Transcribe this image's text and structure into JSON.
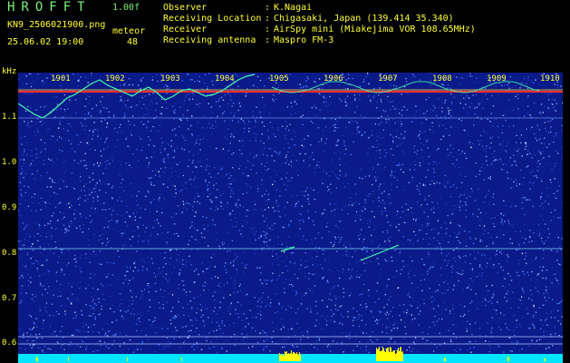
{
  "header": {
    "app_title": "HROFFT",
    "version": "1.00f",
    "filename": "KN9_2506021900.png",
    "meteor_label": "meteor",
    "timestamp": "25.06.02 19:00",
    "meteor_count": "48",
    "info": [
      {
        "key": "Observer",
        "value": "K.Nagai"
      },
      {
        "key": "Receiving Location",
        "value": "Chigasaki, Japan (139.414 35.340)"
      },
      {
        "key": "Receiver",
        "value": "AirSpy mini (Miakejima VOR 108.65MHz)"
      },
      {
        "key": "Receiving antenna",
        "value": "Maspro FM-3"
      }
    ]
  },
  "plot": {
    "unit_label": "kHz",
    "y_ticks": [
      "1.1",
      "1.0",
      "0.9",
      "0.8",
      "0.7",
      "0.6"
    ],
    "x_ticks": [
      "1901",
      "1902",
      "1903",
      "1904",
      "1905",
      "1906",
      "1907",
      "1908",
      "1909",
      "1910"
    ],
    "colors": {
      "background": "#0a1a88",
      "noise": "#3a6cff",
      "carrier": "#ff3030",
      "trace": "#40ffb0",
      "bottom_bar": "#00e5ff",
      "bottom_peaks": "#ffff00",
      "labels": "#ffff33"
    }
  }
}
